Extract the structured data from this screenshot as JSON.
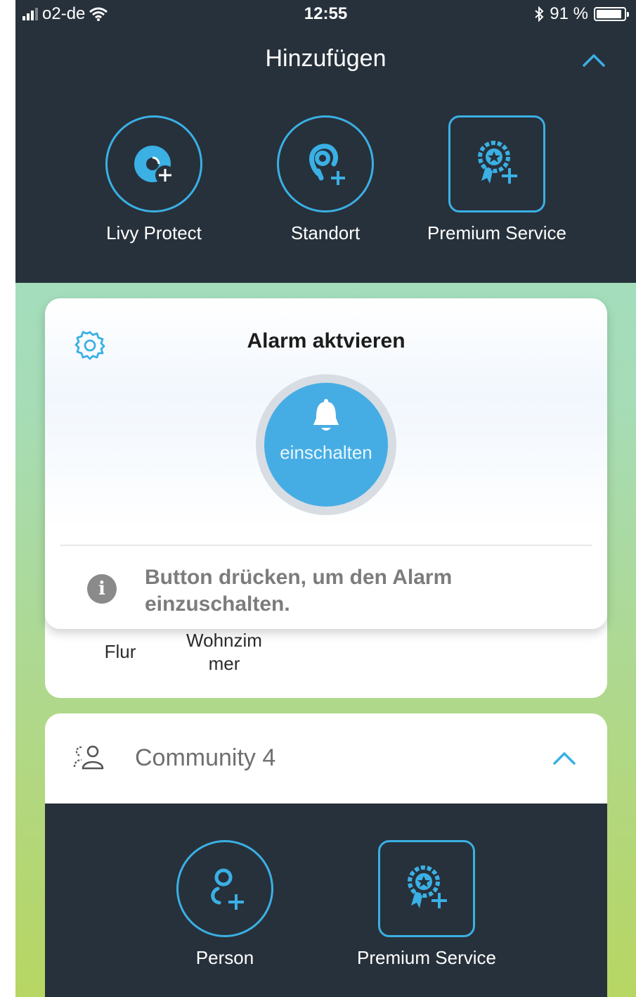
{
  "status_bar": {
    "carrier": "o2-de",
    "time": "12:55",
    "battery_percent": "91 %",
    "battery_level": 0.91
  },
  "header": {
    "title": "Hinzufügen"
  },
  "add_items": [
    {
      "label": "Livy Protect",
      "icon": "livy-protect-add-icon"
    },
    {
      "label": "Standort",
      "icon": "location-add-icon"
    },
    {
      "label": "Premium Service",
      "icon": "premium-badge-add-icon"
    }
  ],
  "alarm_card": {
    "title": "Alarm aktvieren",
    "button_label": "einschalten",
    "info_text": "Button drücken, um den Alarm einzuschalten."
  },
  "rooms": [
    {
      "label": "Flur"
    },
    {
      "label": "Wohnzim mer"
    }
  ],
  "community": {
    "label": "Community 4",
    "items": [
      {
        "label": "Person",
        "icon": "person-add-icon"
      },
      {
        "label": "Premium Service",
        "icon": "premium-badge-add-icon"
      }
    ]
  },
  "colors": {
    "dark_panel": "#27313b",
    "accent": "#3ab0e5",
    "alarm_button": "#46ade4"
  }
}
